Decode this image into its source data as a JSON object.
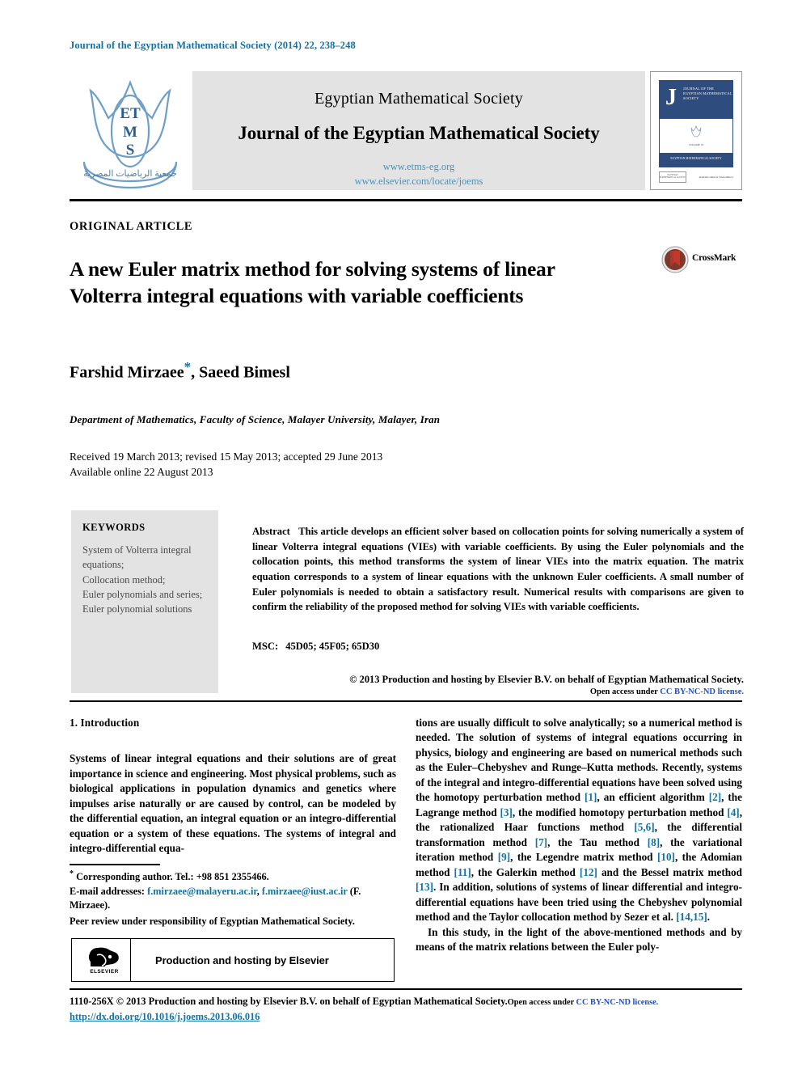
{
  "running_head": "Journal of the Egyptian Mathematical Society (2014) 22, 238–248",
  "masthead": {
    "logo_letters": [
      "E",
      "T",
      "M",
      "S"
    ],
    "logo_arabic": "جمعية الرياضيات المصرية",
    "society_name": "Egyptian Mathematical Society",
    "journal_name": "Journal of the Egyptian Mathematical Society",
    "url_society": "www.etms-eg.org",
    "url_elsevier": "www.elsevier.com/locate/joems",
    "link_color": "#4b90b5",
    "cover": {
      "initial": "J",
      "title_lines": "JOURNAL OF THE EGYPTIAN MATHEMATICAL SOCIETY",
      "mid_caption": "VOLUME 22",
      "bottom_text": "EGYPTIAN MATHEMATICAL SOCIETY",
      "footer_left": "EGYPTIAN MATHEMATICAL SOCIETY",
      "footer_right": "Available online at ScienceDirect",
      "band_color": "#2e4c7d"
    }
  },
  "article": {
    "type": "ORIGINAL ARTICLE",
    "title": "A new Euler matrix method for solving systems of linear Volterra integral equations with variable coefficients",
    "crossmark_label": "CrossMark",
    "authors": "Farshid Mirzaee",
    "authors_rest": ", Saeed Bimesl",
    "corresponding_marker": "*",
    "affiliation": "Department of Mathematics, Faculty of Science, Malayer University, Malayer, Iran",
    "history_line1": "Received 19 March 2013; revised 15 May 2013; accepted 29 June 2013",
    "history_line2": "Available online 22 August 2013"
  },
  "keywords": {
    "heading": "KEYWORDS",
    "list": "System of Volterra integral equations;\nCollocation method;\nEuler polynomials and series;\nEuler polynomial solutions"
  },
  "abstract": {
    "label": "Abstract",
    "text": "This article develops an efficient solver based on collocation points for solving numerically a system of linear Volterra integral equations (VIEs) with variable coefficients. By using the Euler polynomials and the collocation points, this method transforms the system of linear VIEs into the matrix equation. The matrix equation corresponds to a system of linear equations with the unknown Euler coefficients. A small number of Euler polynomials is needed to obtain a satisfactory result. Numerical results with comparisons are given to confirm the reliability of the proposed method for solving VIEs with variable coefficients.",
    "msc_label": "MSC:",
    "msc_codes": "45D05; 45F05; 65D30",
    "copyright": "© 2013 Production and hosting by Elsevier B.V. on behalf of Egyptian Mathematical Society.",
    "open_access_prefix": "Open access under ",
    "open_access_link": "CC BY-NC-ND license.",
    "open_access_link_color": "#1a4fd6"
  },
  "body": {
    "section_heading": "1. Introduction",
    "left_paragraph": "Systems of linear integral equations and their solutions are of great importance in science and engineering. Most physical problems, such as biological applications in population dynamics and genetics where impulses arise naturally or are caused by control, can be modeled by the differential equation, an integral equation or an integro-differential equation or a system of these equations. The systems of integral and integro-differential equa-",
    "right_paragraph_1_a": "tions are usually difficult to solve analytically; so a numerical method is needed. The solution of systems of integral equations occurring in physics, biology and engineering are based on numerical methods such as the Euler–Chebyshev and Runge–Kutta methods. Recently, systems of the integral and integro-differential equations have been solved using the homotopy perturbation method ",
    "ref1": "[1]",
    "right_b": ", an efficient algorithm ",
    "ref2": "[2]",
    "right_c": ", the Lagrange method ",
    "ref3": "[3]",
    "right_d": ", the modified homotopy perturbation method ",
    "ref4": "[4]",
    "right_e": ", the rationalized Haar functions method ",
    "ref56": "[5,6]",
    "right_f": ", the differential transformation method ",
    "ref7": "[7]",
    "right_g": ", the Tau method ",
    "ref8": "[8]",
    "right_h": ", the variational iteration method ",
    "ref9": "[9]",
    "right_i": ", the Legendre matrix method ",
    "ref10": "[10]",
    "right_j": ", the Adomian method ",
    "ref11": "[11]",
    "right_k": ", the Galerkin method ",
    "ref12": "[12]",
    "right_l": " and the Bessel matrix method ",
    "ref13": "[13]",
    "right_m": ". In addition, solutions of systems of linear differential and integro-differential equations have been tried using the Chebyshev polynomial method and the Taylor collocation method by Sezer et al. ",
    "ref1415": "[14,15]",
    "right_n": ".",
    "right_paragraph_2": "In this study, in the light of the above-mentioned methods and by means of the matrix relations between the Euler poly-"
  },
  "footnotes": {
    "corr_marker": "*",
    "corr_text": "Corresponding author. Tel.: +98 851 2355466.",
    "email_label": "E-mail addresses:",
    "email_1": "f.mirzaee@malayeru.ac.ir",
    "email_sep": ", ",
    "email_2": "f.mirzaee@iust.ac.ir",
    "email_suffix": " (F. Mirzaee).",
    "peer_review": "Peer review under responsibility of Egyptian Mathematical Society.",
    "link_color": "#1072a6"
  },
  "elsevier_box": {
    "wordmark": "ELSEVIER",
    "caption": "Production and hosting by Elsevier"
  },
  "footer": {
    "issn_line": "1110-256X © 2013 Production and hosting by Elsevier B.V. on behalf of Egyptian Mathematical Society.",
    "open_access_prefix": "Open access under ",
    "open_access_link": "CC BY-NC-ND license.",
    "doi": "http://dx.doi.org/10.1016/j.joems.2013.06.016"
  }
}
